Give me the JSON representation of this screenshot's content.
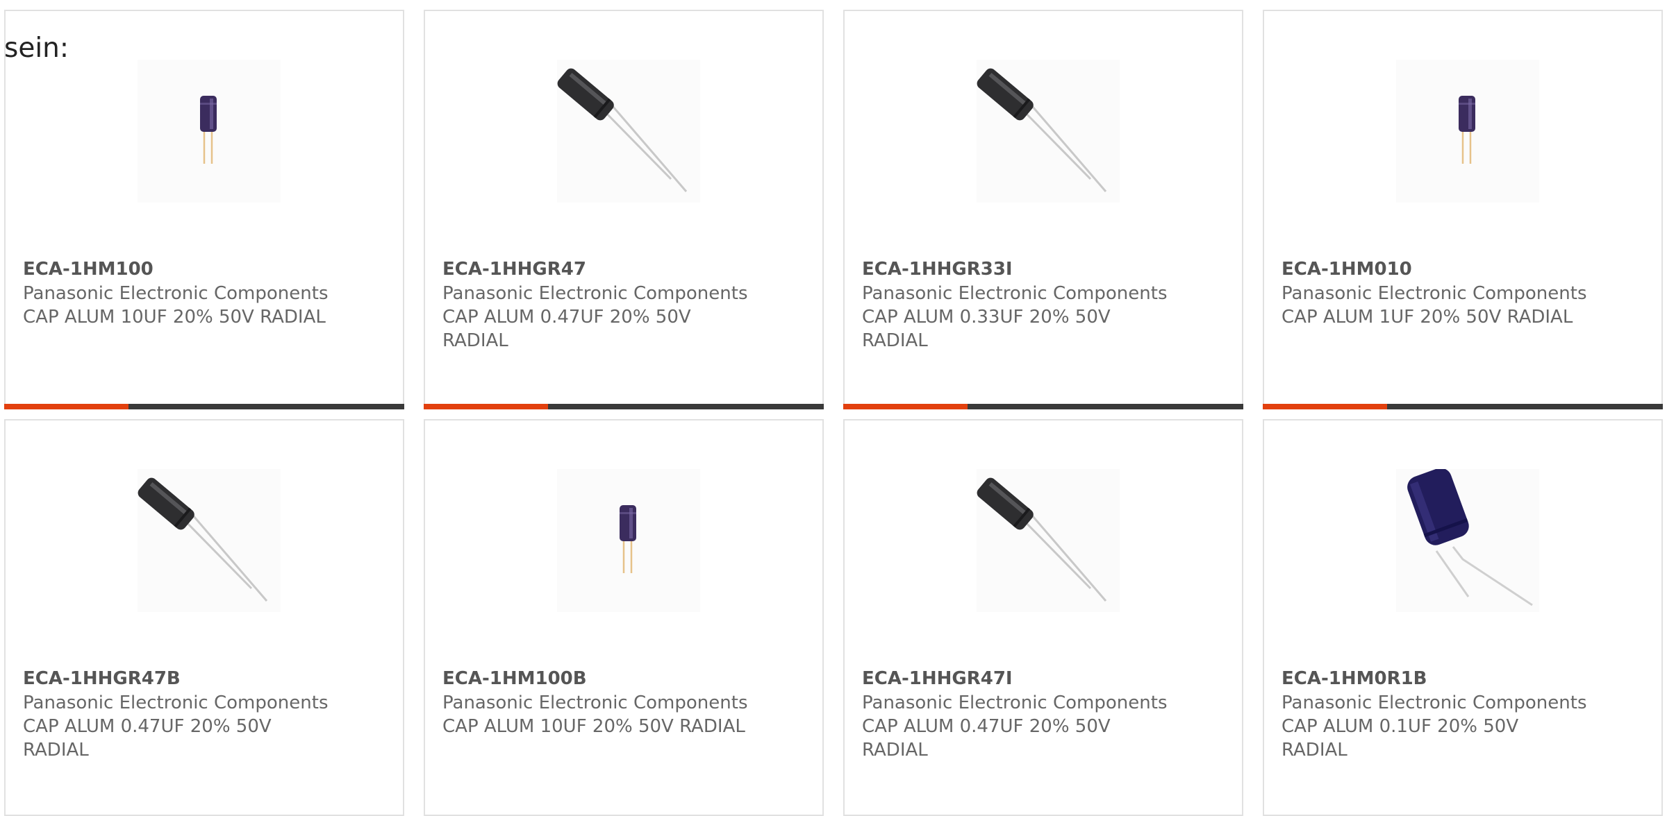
{
  "intro_text": "sein:",
  "colors": {
    "accent": "#e2400e",
    "bar": "#3a3a3a",
    "border": "#e1e1e1",
    "text": "#666666",
    "part_number": "#555555",
    "capacitor_body": "#3b2c5e"
  },
  "products": [
    {
      "part_number": "ECA-1HM100",
      "manufacturer": "Panasonic Electronic Components",
      "description": "CAP ALUM 10UF 20% 50V RADIAL",
      "image_icon": "capacitor-small-upright-icon",
      "progress": 0.31,
      "show_bar": true
    },
    {
      "part_number": "ECA-1HHGR47",
      "manufacturer": "Panasonic Electronic Components",
      "description": "CAP ALUM 0.47UF 20% 50V RADIAL",
      "image_icon": "capacitor-angled-icon",
      "progress": 0.31,
      "show_bar": true
    },
    {
      "part_number": "ECA-1HHGR33I",
      "manufacturer": "Panasonic Electronic Components",
      "description": "CAP ALUM 0.33UF 20% 50V RADIAL",
      "image_icon": "capacitor-angled-icon",
      "progress": 0.31,
      "show_bar": true
    },
    {
      "part_number": "ECA-1HM010",
      "manufacturer": "Panasonic Electronic Components",
      "description": "CAP ALUM 1UF 20% 50V RADIAL",
      "image_icon": "capacitor-small-upright-icon",
      "progress": 0.31,
      "show_bar": true
    },
    {
      "part_number": "ECA-1HHGR47B",
      "manufacturer": "Panasonic Electronic Components",
      "description": "CAP ALUM 0.47UF 20% 50V RADIAL",
      "image_icon": "capacitor-angled-icon",
      "progress": 0,
      "show_bar": false
    },
    {
      "part_number": "ECA-1HM100B",
      "manufacturer": "Panasonic Electronic Components",
      "description": "CAP ALUM 10UF 20% 50V RADIAL",
      "image_icon": "capacitor-small-upright-icon",
      "progress": 0,
      "show_bar": false
    },
    {
      "part_number": "ECA-1HHGR47I",
      "manufacturer": "Panasonic Electronic Components",
      "description": "CAP ALUM 0.47UF 20% 50V RADIAL",
      "image_icon": "capacitor-angled-icon",
      "progress": 0,
      "show_bar": false
    },
    {
      "part_number": "ECA-1HM0R1B",
      "manufacturer": "Panasonic Electronic Components",
      "description": "CAP ALUM 0.1UF 20% 50V RADIAL",
      "image_icon": "capacitor-large-bent-icon",
      "progress": 0,
      "show_bar": false
    }
  ]
}
